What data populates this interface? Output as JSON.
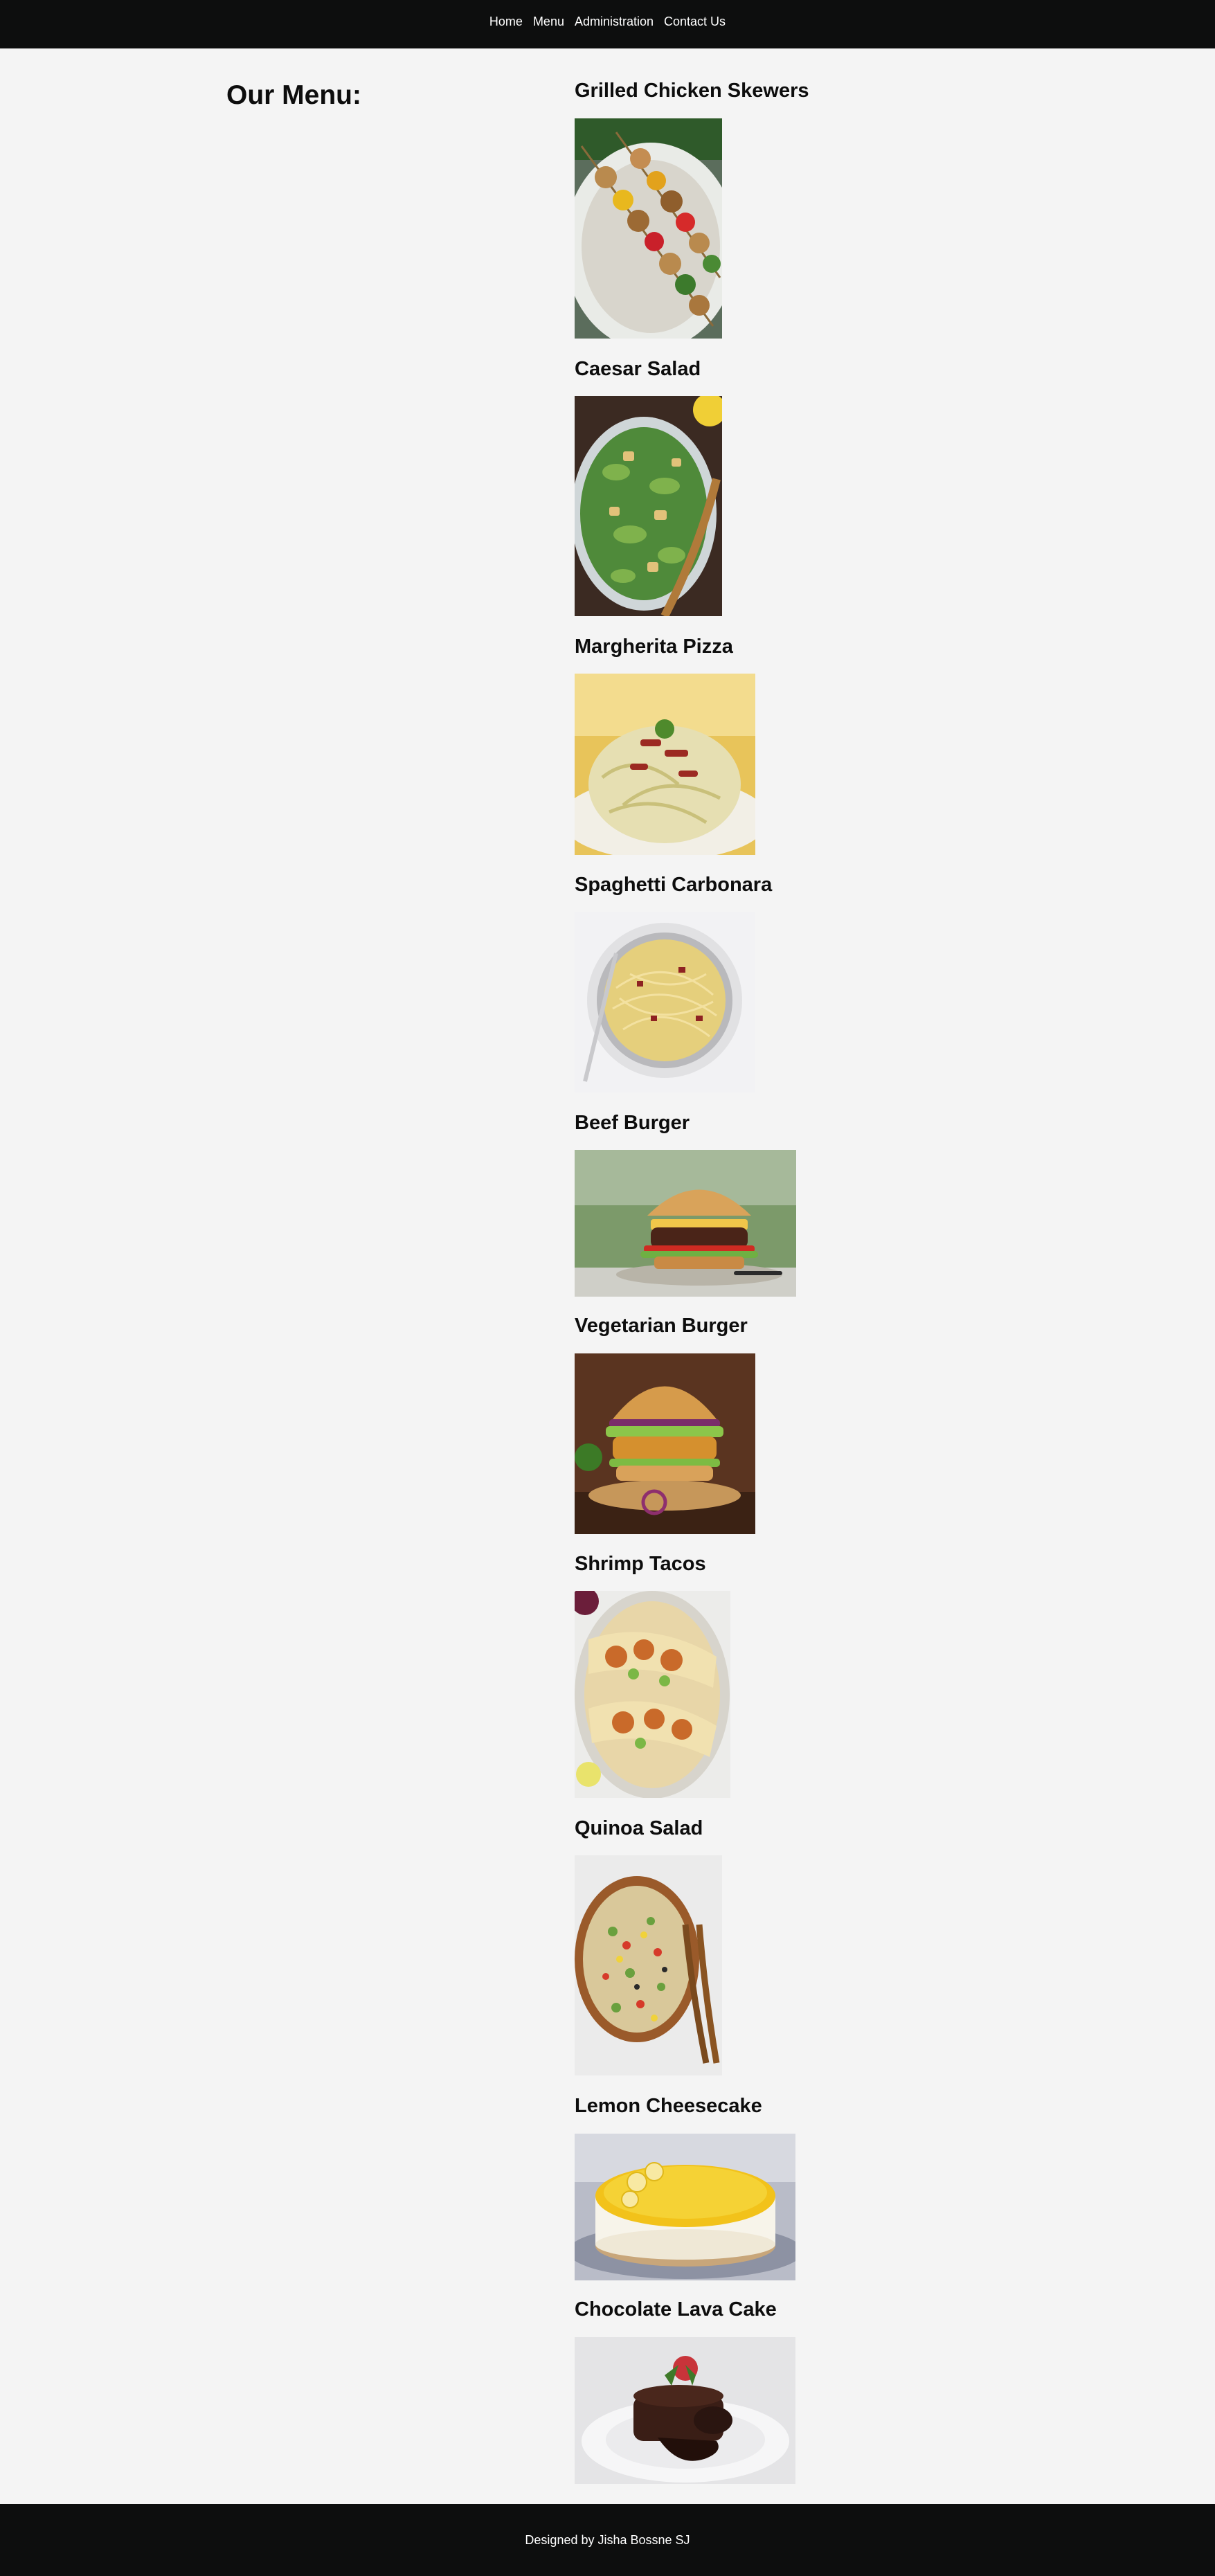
{
  "nav": {
    "items": [
      {
        "label": "Home"
      },
      {
        "label": "Menu"
      },
      {
        "label": "Administration"
      },
      {
        "label": "Contact Us"
      }
    ]
  },
  "main": {
    "heading": "Our Menu:",
    "items": [
      {
        "name": "Grilled Chicken Skewers"
      },
      {
        "name": "Caesar Salad"
      },
      {
        "name": "Margherita Pizza"
      },
      {
        "name": "Spaghetti Carbonara"
      },
      {
        "name": "Beef Burger"
      },
      {
        "name": "Vegetarian Burger"
      },
      {
        "name": "Shrimp Tacos"
      },
      {
        "name": "Quinoa Salad"
      },
      {
        "name": "Lemon Cheesecake"
      },
      {
        "name": "Chocolate Lava Cake"
      }
    ]
  },
  "footer": {
    "credit": "Designed by Jisha Bossne SJ"
  }
}
